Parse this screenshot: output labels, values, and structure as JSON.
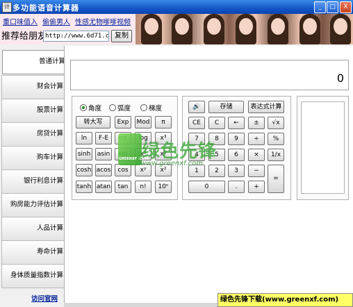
{
  "window": {
    "title": "多功能语音计算器",
    "icon": "计",
    "minimize": "_",
    "maximize": "□",
    "close": "X"
  },
  "header": {
    "links": [
      "重口味值入",
      "偷偷男人",
      "性感尤物嗲嗲视频"
    ],
    "recommend_label": "推荐给朋友",
    "url_value": "http://www.6d71.c",
    "copy_label": "复制"
  },
  "sidebar": {
    "items": [
      "普通计算",
      "财会计算",
      "股票计算",
      "房贷计算",
      "购车计算",
      "银行利息计算",
      "购房能力评估计算",
      "人品计算",
      "寿命计算",
      "身体质量指数计算"
    ],
    "active_index": 0,
    "site_link": "访问官网"
  },
  "display": {
    "value": "0"
  },
  "angle_modes": {
    "options": [
      "角度",
      "弧度",
      "梯度"
    ],
    "selected": 0
  },
  "sci_buttons": [
    [
      "转大写",
      "Exp",
      "Mod",
      "π"
    ],
    [
      "ln",
      "F-E",
      "Int",
      "log",
      "x³"
    ],
    [
      "sinh",
      "asin",
      "sin",
      "x²",
      "x³"
    ],
    [
      "cosh",
      "acos",
      "cos",
      "xʸ",
      "x²"
    ],
    [
      "tanh",
      "atan",
      "tan",
      "n!",
      "10ⁿ"
    ]
  ],
  "num_panel": {
    "top": [
      "🔊",
      "存储",
      "表达式计算"
    ],
    "rows": [
      [
        "CE",
        "C",
        "←",
        "±",
        "√x"
      ],
      [
        "7",
        "8",
        "9",
        "÷",
        "%"
      ],
      [
        "4",
        "5",
        "6",
        "×",
        "1/x"
      ],
      [
        "1",
        "2",
        "3",
        "−"
      ]
    ],
    "bottom": [
      "0",
      ".",
      "+"
    ],
    "equals": "="
  },
  "watermark": {
    "text": "绿色先锋",
    "url": "www.greenxf.com",
    "logo_text": "GREENXF .COM",
    "footer": "绿色先锋下载(www.greenxf.com)"
  },
  "colors": {
    "titlebar": "#1456c8",
    "link": "#00209a",
    "watermark": "#3ea83a",
    "footer_bg": "#ffff66"
  }
}
